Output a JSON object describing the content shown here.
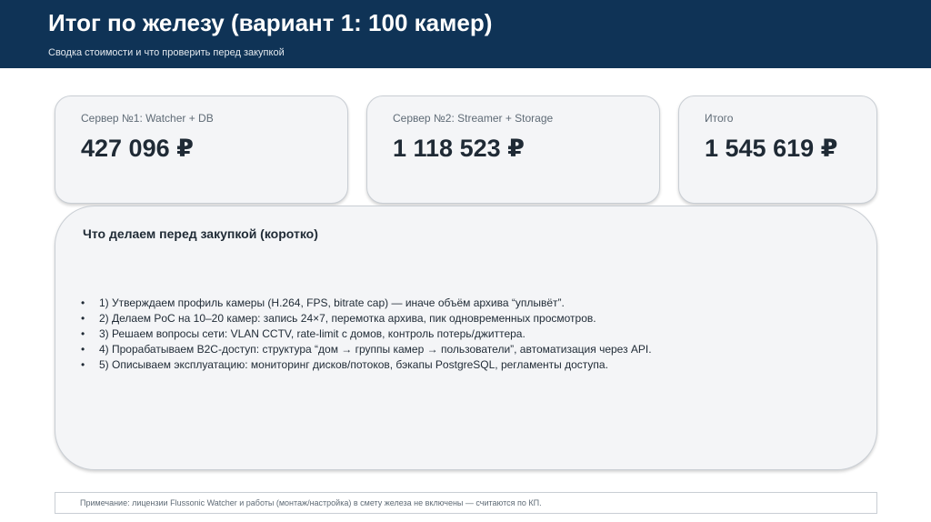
{
  "header": {
    "title": "Итог по железу (вариант 1: 100 камер)",
    "subtitle": "Сводка стоимости и что проверить перед закупкой"
  },
  "cards": [
    {
      "label": "Сервер №1: Watcher + DB",
      "value": "427 096 ₽"
    },
    {
      "label": "Сервер №2: Streamer + Storage",
      "value": "1 118 523 ₽"
    },
    {
      "label": "Итого",
      "value": "1 545 619 ₽"
    }
  ],
  "panel": {
    "title": "Что делаем перед закупкой (коротко)",
    "bullet_glyph": "•",
    "items": [
      "1) Утверждаем профиль камеры (H.264, FPS, bitrate cap) — иначе объём архива “уплывёт”.",
      "2) Делаем PoC на 10–20 камер: запись 24×7, перемотка архива, пик одновременных просмотров.",
      "3) Решаем вопросы сети: VLAN CCTV, rate-limit с домов, контроль потерь/джиттера.",
      "4) Прорабатываем B2C-доступ: структура “дом → группы камер → пользователи”, автоматизация через API.",
      "5) Описываем эксплуатацию: мониторинг дисков/потоков, бэкапы PostgreSQL, регламенты доступа."
    ]
  },
  "note": {
    "text": "Примечание: лицензии Flussonic Watcher и работы (монтаж/настройка) в смету железа не включены — считаются по КП."
  },
  "colors": {
    "header_bg": "#0f3356",
    "card_bg": "#f4f5f7",
    "card_border": "#c9ced4",
    "text_dark": "#1f2a35",
    "text_muted": "#5f6b76"
  }
}
